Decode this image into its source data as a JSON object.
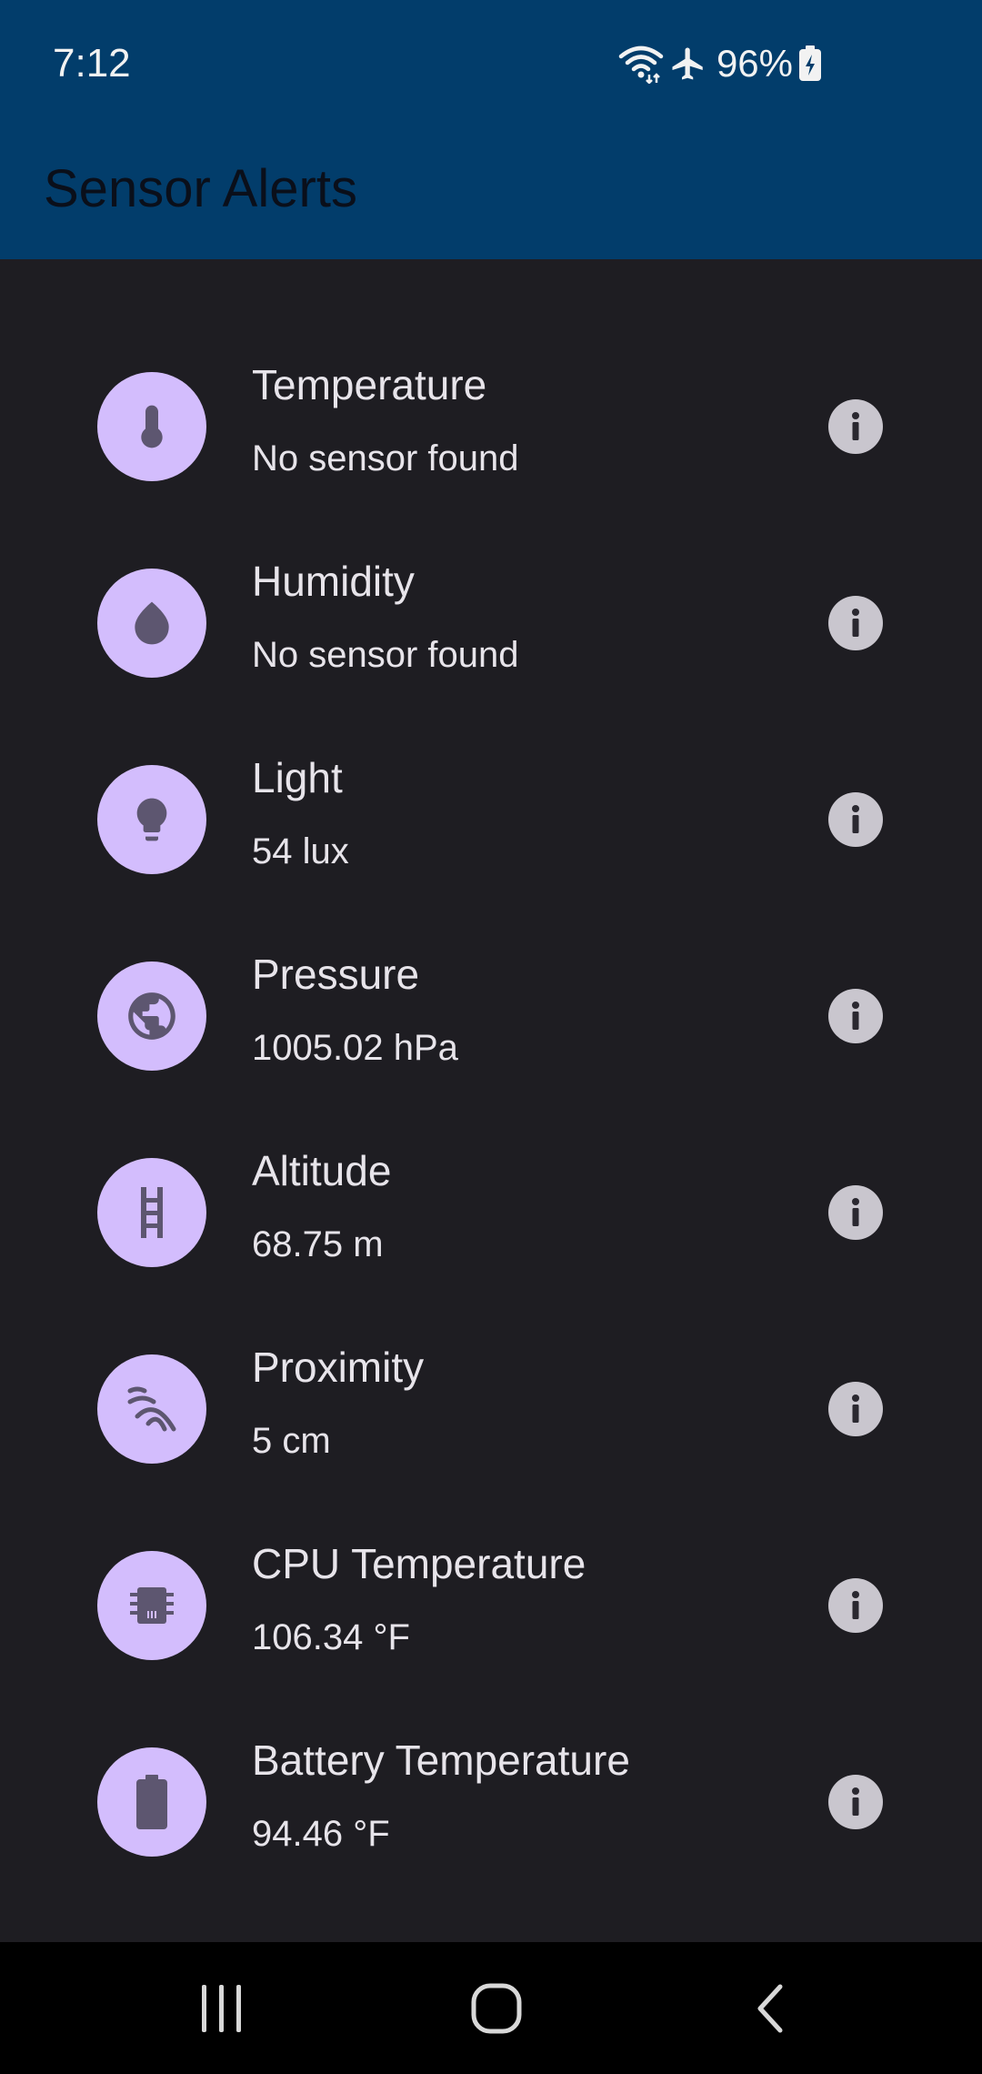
{
  "status_bar": {
    "time": "7:12",
    "battery_percent": "96%",
    "icons": [
      "wifi-icon",
      "airplane-mode-icon",
      "battery-charging-icon"
    ]
  },
  "app_bar": {
    "title": "Sensor Alerts"
  },
  "sensors": [
    {
      "title": "Temperature",
      "value": "No sensor found",
      "icon": "thermometer-icon"
    },
    {
      "title": "Humidity",
      "value": "No sensor found",
      "icon": "water-drop-icon"
    },
    {
      "title": "Light",
      "value": "54 lux",
      "icon": "lightbulb-icon"
    },
    {
      "title": "Pressure",
      "value": "1005.02 hPa",
      "icon": "globe-icon"
    },
    {
      "title": "Altitude",
      "value": "68.75 m",
      "icon": "ladder-icon"
    },
    {
      "title": "Proximity",
      "value": "5 cm",
      "icon": "proximity-waves-icon"
    },
    {
      "title": "CPU Temperature",
      "value": "106.34 °F",
      "icon": "cpu-chip-icon"
    },
    {
      "title": "Battery Temperature",
      "value": "94.46 °F",
      "icon": "battery-icon"
    }
  ],
  "nav_bar": {
    "buttons": [
      "recents",
      "home",
      "back"
    ]
  },
  "colors": {
    "app_bar": "#023d6b",
    "background": "#1e1d22",
    "icon_circle": "#d3bdfd",
    "icon_glyph": "#5d5670",
    "info_button": "#c9c6ce",
    "text": "#e7e4ea"
  }
}
